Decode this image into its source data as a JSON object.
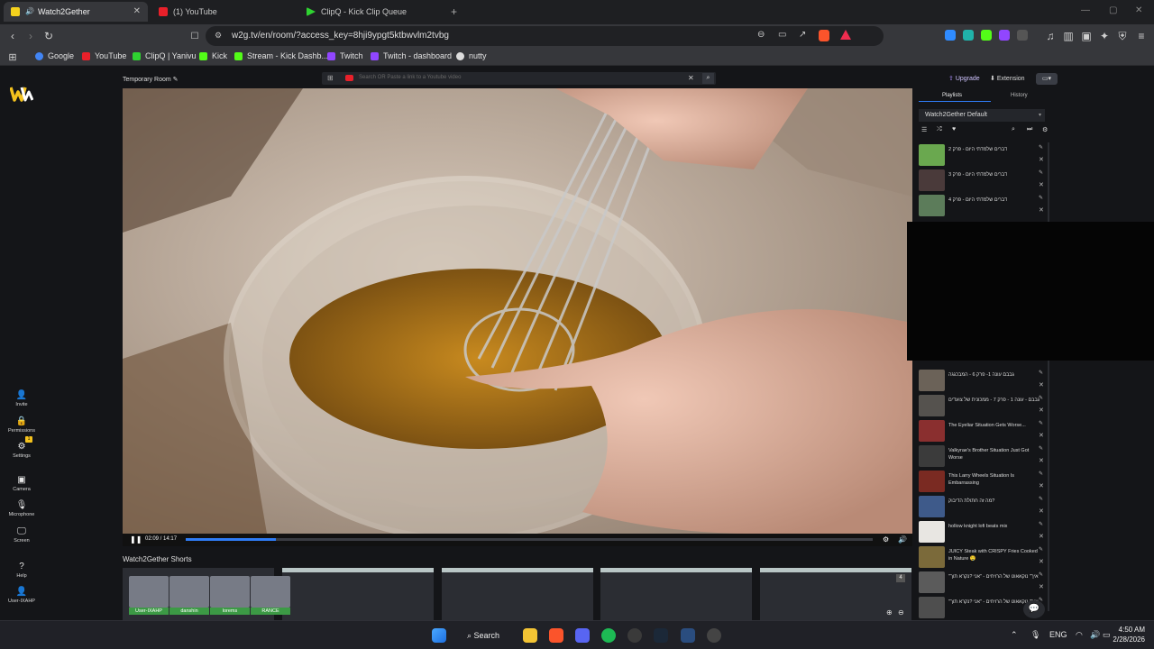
{
  "browser": {
    "tabs": [
      {
        "title": "Watch2Gether",
        "favicon_color": "#f4d11d",
        "active": true
      },
      {
        "title": "(1) YouTube",
        "favicon_color": "#e8202a",
        "active": false
      },
      {
        "title": "ClipQ - Kick Clip Queue",
        "favicon_color": "#2fd331",
        "active": false
      }
    ],
    "new_tab_icon": "plus-icon",
    "window_controls": [
      "minimize-icon",
      "maximize-icon",
      "close-icon"
    ],
    "url": "w2g.tv/en/room/?access_key=8hji9ypgt5ktbwvlm2tvbg",
    "bookmarks": [
      {
        "label": "Google",
        "color": "#4285f4"
      },
      {
        "label": "YouTube",
        "color": "#e8202a"
      },
      {
        "label": "ClipQ | Yanivu",
        "color": "#2fd331"
      },
      {
        "label": "Kick",
        "color": "#53fc18"
      },
      {
        "label": "Stream - Kick Dashb...",
        "color": "#53fc18"
      },
      {
        "label": "Twitch",
        "color": "#9146ff"
      },
      {
        "label": "Twitch - dashboard",
        "color": "#9146ff"
      },
      {
        "label": "nutty",
        "color": "#dddddd"
      }
    ]
  },
  "app": {
    "room_name": "Temporary Room",
    "search_placeholder": "Search OR Paste a link to a Youtube video",
    "upgrade_label": "Upgrade",
    "extension_label": "Extension",
    "rail": {
      "invite": "Invite",
      "permissions": "Permissions",
      "settings": "Settings",
      "settings_badge": "1",
      "camera": "Camera",
      "microphone": "Microphone",
      "screen": "Screen",
      "help": "Help",
      "user": "User-IXAHP"
    },
    "player": {
      "time": "02:09 / 14:17",
      "progress": 0.131
    },
    "shorts_title": "Watch2Gether Shorts",
    "shorts_badge": "4",
    "users": [
      "User-IXAHP",
      "danshin",
      "lorems",
      "RANCE"
    ],
    "panel": {
      "tab_playlists": "Playlists",
      "tab_history": "History",
      "playlist_name": "Watch2Gether Default",
      "items": [
        {
          "title": "דברים שלמדתי היום - פרק 2",
          "color": "#6aa84f"
        },
        {
          "title": "דברים שלמדתי היום - פרק 3",
          "color": "#4a3a3a"
        },
        {
          "title": "דברים שלמדתי היום - פרק 4",
          "color": "#5c7c5a"
        },
        {
          "title": "גבבם עונה 1- פרק 6 - המבכגגה",
          "color": "#6b6258"
        },
        {
          "title": "גבבם - עונה 1 - פרק 7 - ממכונית של צועדים",
          "color": "#55524e"
        },
        {
          "title": "The Eyeliar Situation Gets Worse...",
          "color": "#8a2f2f"
        },
        {
          "title": "Valkyrae's Brother Situation Just Got Worse",
          "color": "#3b3b3b"
        },
        {
          "title": "This Larry Wheels Situation Is Embarrassing",
          "color": "#7a2a22"
        },
        {
          "title": "מה זה חתולת הדיבוק?",
          "color": "#3e5a8a"
        },
        {
          "title": "hollow knight lofi beats mix",
          "color": "#e8e6e2"
        },
        {
          "title": "JUICY Steak with CRISPY Fries Cooked in Nature 🤤",
          "color": "#7b6a3a"
        },
        {
          "title": "\"איך\" נוקאאוט של הרויחים - \"אני ?נקרא תוך",
          "color": "#5b5b5b"
        },
        {
          "title": "\"איך\" נוקאאוט של הרויחים - \"אני ?נקרא תוך",
          "color": "#4e4e4e"
        }
      ]
    }
  },
  "taskbar": {
    "search_label": "Search",
    "language": "ENG",
    "time": "4:50 AM",
    "date": "2/28/2026"
  }
}
